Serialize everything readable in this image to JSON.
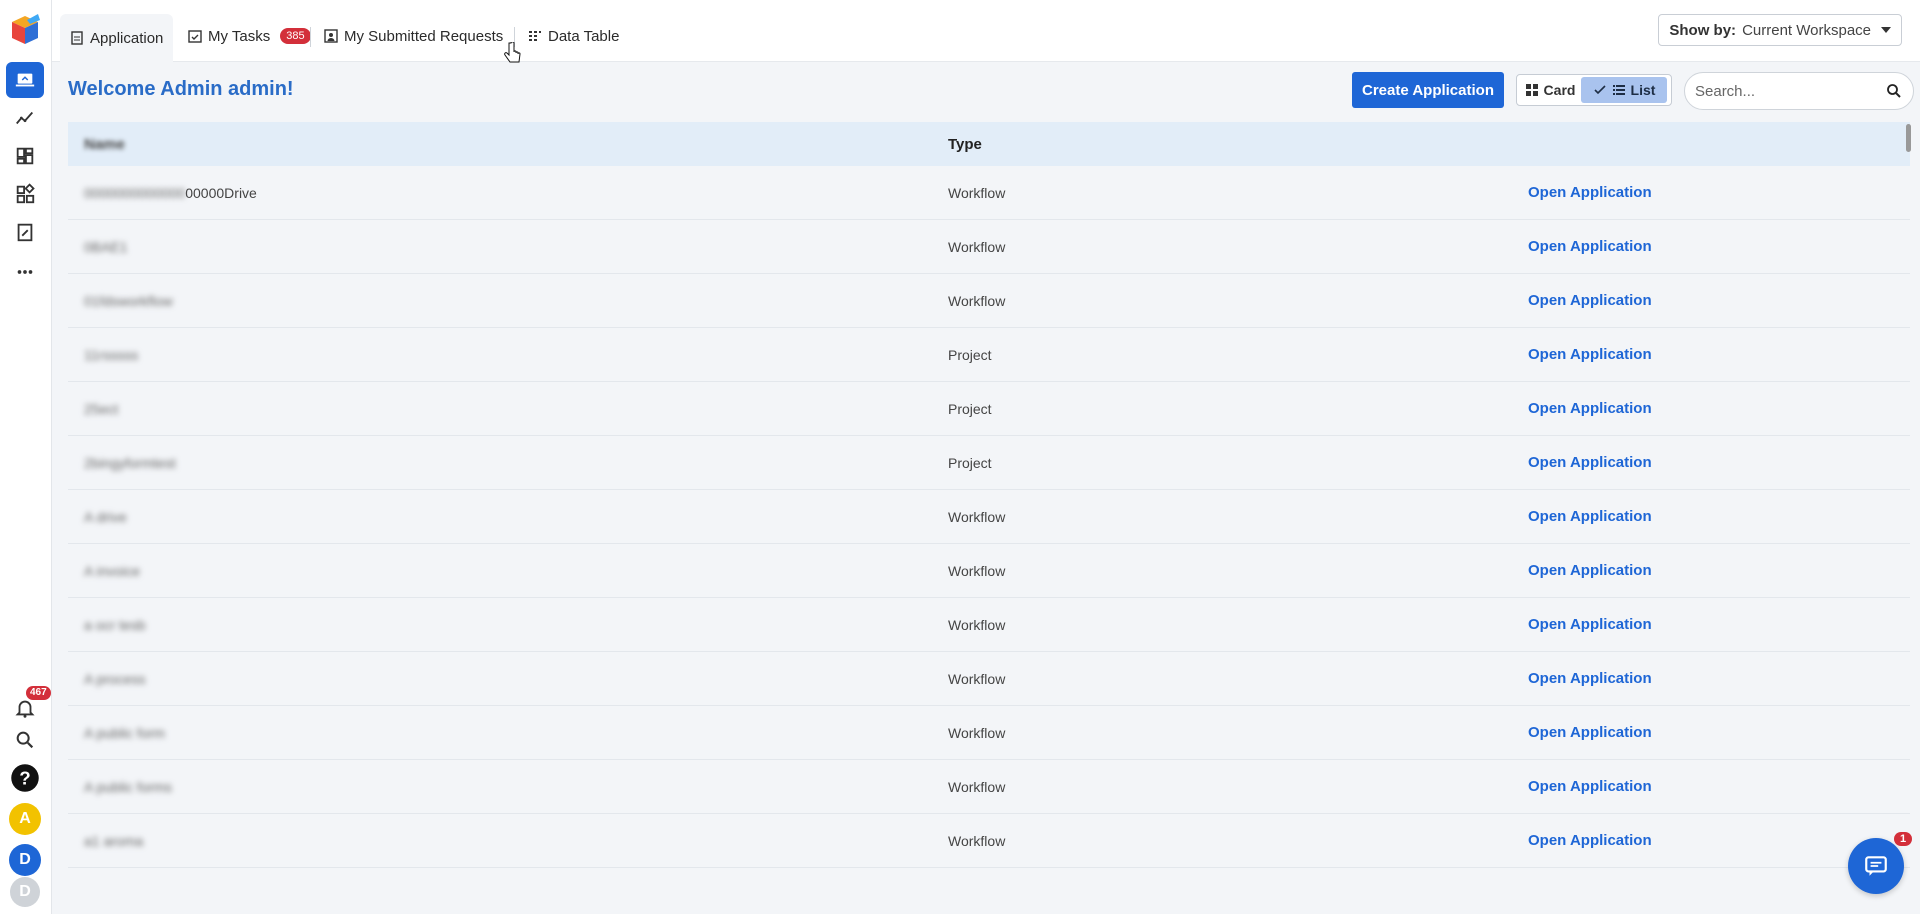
{
  "colors": {
    "accent": "#1e66d6",
    "badge": "#d32f3a",
    "welcome": "#2a6cc7",
    "header_row": "#e2edf8"
  },
  "sidebar": {
    "items": [
      {
        "name": "applications",
        "icon": "laptop-icon"
      },
      {
        "name": "analytics",
        "icon": "trend-icon"
      },
      {
        "name": "dashboard",
        "icon": "grid-icon"
      },
      {
        "name": "widgets",
        "icon": "widgets-icon"
      },
      {
        "name": "tasks",
        "icon": "task-icon"
      },
      {
        "name": "more",
        "icon": "more-icon"
      }
    ],
    "notifications_count": "467",
    "avatars": [
      {
        "letter": "A",
        "color": "#f2c200"
      },
      {
        "letter": "D",
        "color": "#1e66d6"
      },
      {
        "letter": "D",
        "color": "#cfd3d8"
      }
    ]
  },
  "tabs": {
    "application": "Application",
    "my_tasks": "My Tasks",
    "my_tasks_badge": "385",
    "submitted": "My Submitted Requests",
    "data_table": "Data Table"
  },
  "show_by": {
    "label": "Show by:",
    "value": "Current Workspace"
  },
  "header": {
    "welcome": "Welcome Admin admin!",
    "create_button": "Create Application",
    "view_card": "Card",
    "view_list": "List",
    "search_placeholder": "Search..."
  },
  "table": {
    "columns": {
      "name": "Name",
      "type": "Type"
    },
    "rows": [
      {
        "name_hidden": "0000000000000",
        "name_visible": "00000Drive",
        "type": "Workflow",
        "action": "Open Application"
      },
      {
        "name_hidden": "0BAE1",
        "name_visible": "",
        "type": "Workflow",
        "action": "Open Application"
      },
      {
        "name_hidden": "01fdsworkflow",
        "name_visible": "",
        "type": "Workflow",
        "action": "Open Application"
      },
      {
        "name_hidden": "11rsssss",
        "name_visible": "",
        "type": "Project",
        "action": "Open Application"
      },
      {
        "name_hidden": "25ect",
        "name_visible": "",
        "type": "Project",
        "action": "Open Application"
      },
      {
        "name_hidden": "2bingyformtest",
        "name_visible": "",
        "type": "Project",
        "action": "Open Application"
      },
      {
        "name_hidden": "A drive",
        "name_visible": "",
        "type": "Workflow",
        "action": "Open Application"
      },
      {
        "name_hidden": "A invoice",
        "name_visible": "",
        "type": "Workflow",
        "action": "Open Application"
      },
      {
        "name_hidden": "a ocr tesb",
        "name_visible": "",
        "type": "Workflow",
        "action": "Open Application"
      },
      {
        "name_hidden": "A process",
        "name_visible": "",
        "type": "Workflow",
        "action": "Open Application"
      },
      {
        "name_hidden": "A public form",
        "name_visible": "",
        "type": "Workflow",
        "action": "Open Application"
      },
      {
        "name_hidden": "A public forms",
        "name_visible": "",
        "type": "Workflow",
        "action": "Open Application"
      },
      {
        "name_hidden": "a1 aroma",
        "name_visible": "",
        "type": "Workflow",
        "action": "Open Application"
      }
    ]
  },
  "chat": {
    "badge": "1"
  }
}
